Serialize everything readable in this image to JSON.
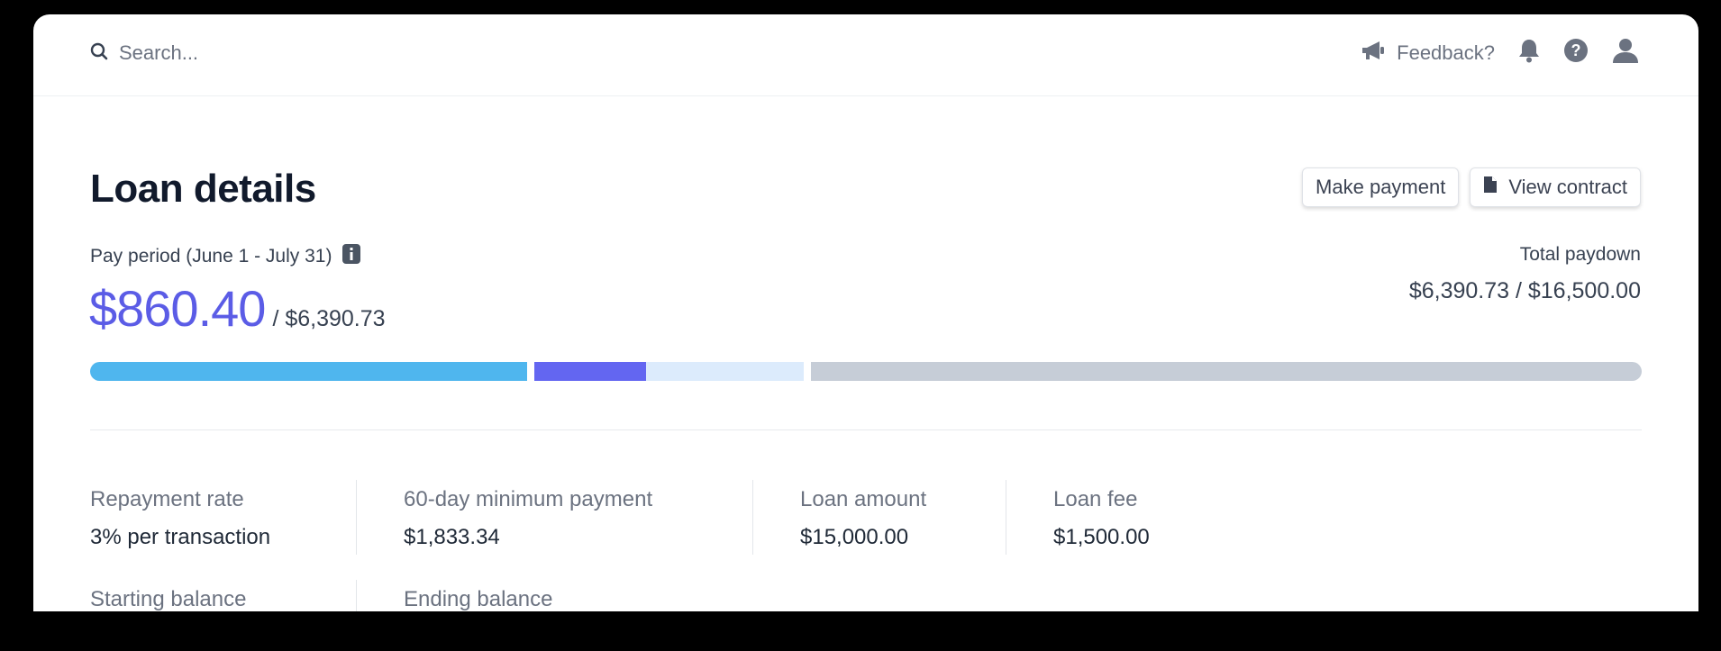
{
  "search": {
    "placeholder": "Search..."
  },
  "topbar": {
    "feedback_label": "Feedback?"
  },
  "page": {
    "title": "Loan details"
  },
  "actions": {
    "make_payment": "Make payment",
    "view_contract": "View contract"
  },
  "pay_period": {
    "label": "Pay period (June 1 - July 31)",
    "paid": "$860.40",
    "due": "/ $6,390.73"
  },
  "total_paydown": {
    "label": "Total paydown",
    "value": "$6,390.73 / $16,500.00"
  },
  "progress": {
    "segments": [
      {
        "name": "paid",
        "color": "#4fb6ee"
      },
      {
        "name": "period",
        "color": "#6366f1"
      },
      {
        "name": "remaining",
        "color": "#dcebfc"
      },
      {
        "name": "future",
        "color": "#c6cdd7"
      }
    ]
  },
  "stats": {
    "repayment_rate": {
      "label": "Repayment rate",
      "value": "3% per transaction"
    },
    "minimum_payment": {
      "label": "60-day minimum payment",
      "value": "$1,833.34"
    },
    "loan_amount": {
      "label": "Loan amount",
      "value": "$15,000.00"
    },
    "loan_fee": {
      "label": "Loan fee",
      "value": "$1,500.00"
    },
    "starting_balance": {
      "label": "Starting balance"
    },
    "ending_balance": {
      "label": "Ending balance"
    }
  },
  "colors": {
    "accent": "#5b5ce6",
    "title": "#111a2c",
    "muted": "#6b7280"
  },
  "icons": [
    "search-icon",
    "megaphone-icon",
    "bell-icon",
    "help-icon",
    "user-icon",
    "document-icon",
    "info-icon"
  ]
}
